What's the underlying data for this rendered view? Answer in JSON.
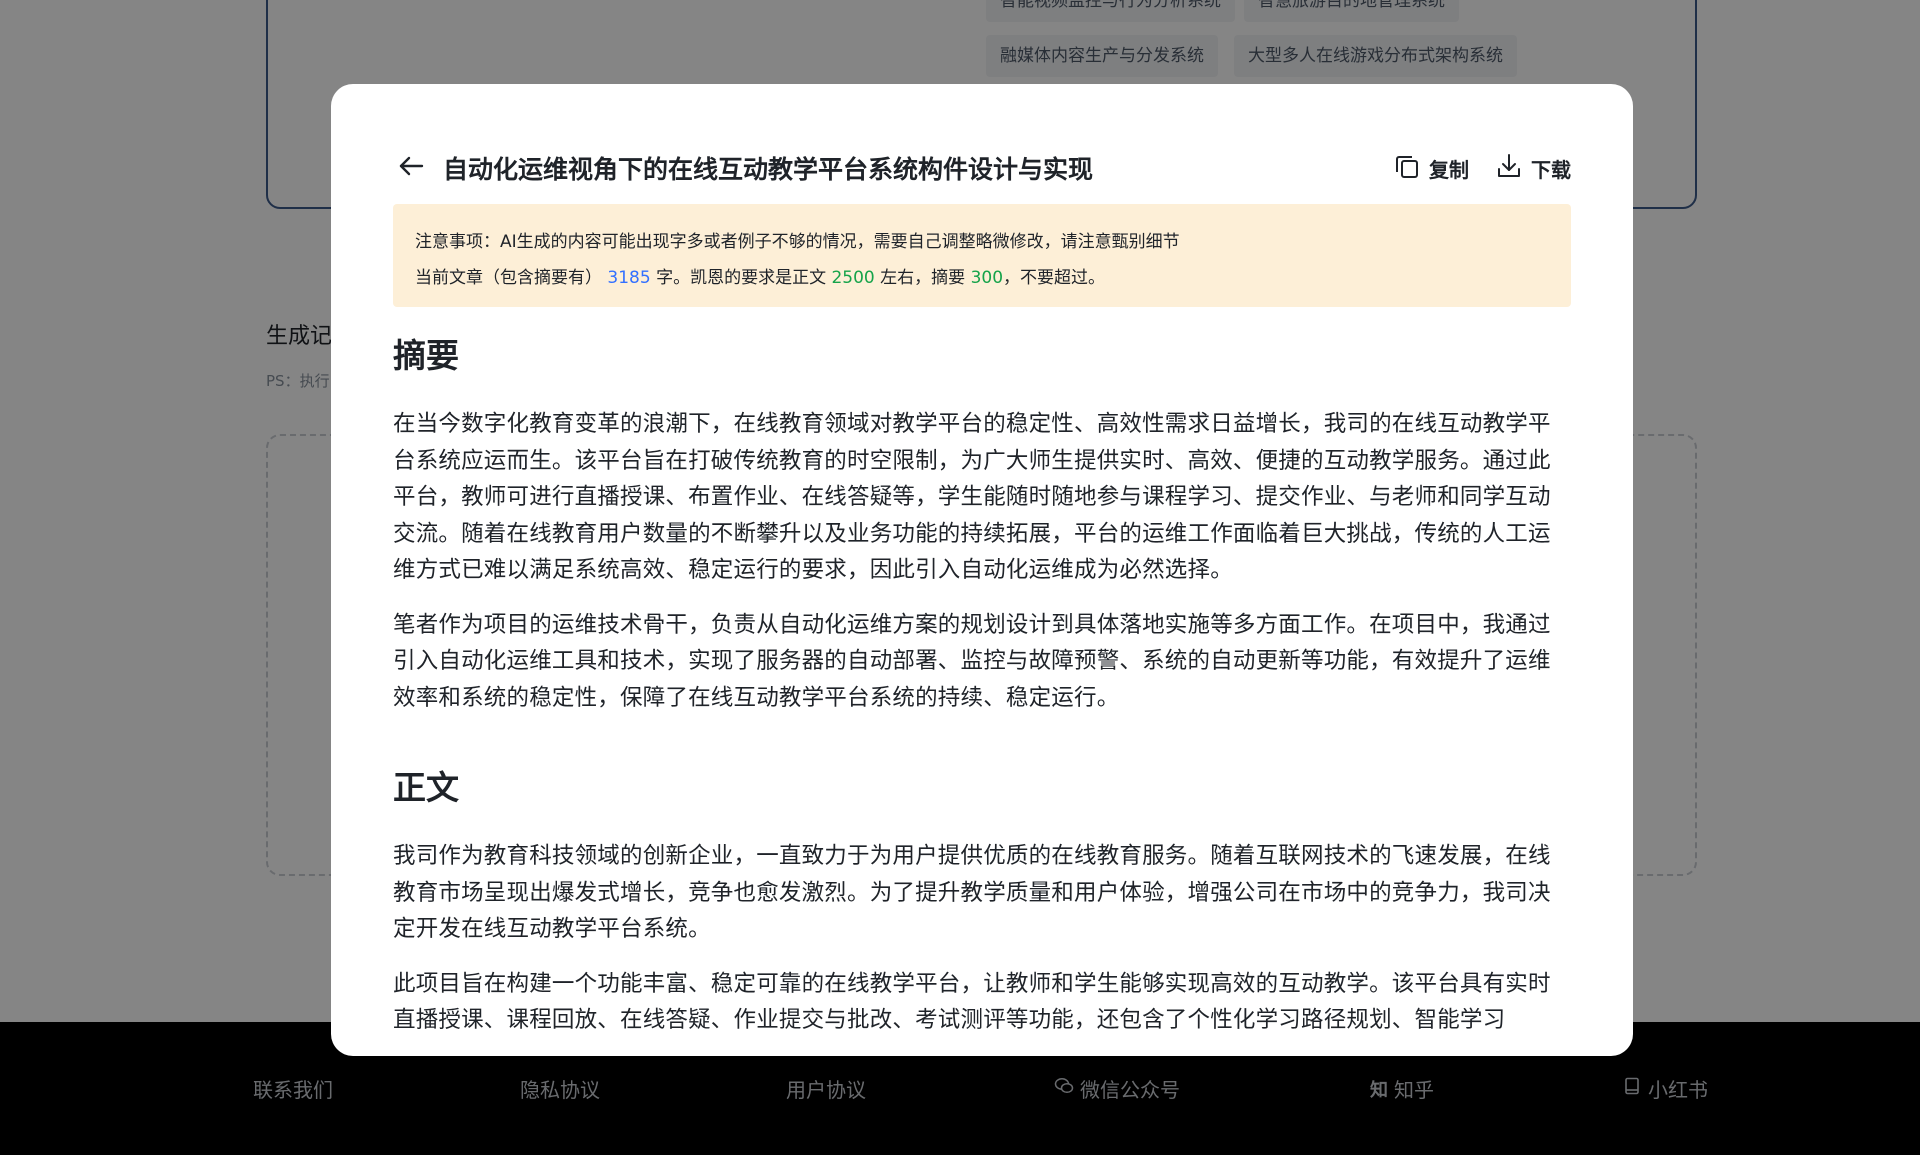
{
  "background": {
    "tags": [
      {
        "text": "智能视频监控与行为分析系统"
      },
      {
        "text": "智慧旅游目的地管理系统"
      },
      {
        "text": "融媒体内容生产与分发系统"
      },
      {
        "text": "大型多人在线游戏分布式架构系统"
      }
    ],
    "section_title": "生成记",
    "ps_text": "PS：执行"
  },
  "footer": {
    "links": [
      {
        "label": "联系我们"
      },
      {
        "label": "隐私协议"
      },
      {
        "label": "用户协议"
      },
      {
        "label": "微信公众号"
      },
      {
        "label": "知乎"
      },
      {
        "label": "小红书"
      }
    ]
  },
  "modal": {
    "title": "自动化运维视角下的在线互动教学平台系统构件设计与实现",
    "copy_label": "复制",
    "download_label": "下载",
    "notice": {
      "line1": "注意事项：AI生成的内容可能出现字多或者例子不够的情况，需要自己调整略微修改，请注意甄别细节",
      "line2_prefix": "当前文章（包含摘要有）",
      "word_count": "3185",
      "line2_mid1": "字。凯恩的要求是正文",
      "body_target": "2500",
      "line2_mid2": "左右，摘要",
      "abstract_target": "300",
      "line2_suffix": "，不要超过。"
    },
    "sections": {
      "abstract_heading": "摘要",
      "abstract_p1": "在当今数字化教育变革的浪潮下，在线教育领域对教学平台的稳定性、高效性需求日益增长，我司的在线互动教学平台系统应运而生。该平台旨在打破传统教育的时空限制，为广大师生提供实时、高效、便捷的互动教学服务。通过此平台，教师可进行直播授课、布置作业、在线答疑等，学生能随时随地参与课程学习、提交作业、与老师和同学互动交流。随着在线教育用户数量的不断攀升以及业务功能的持续拓展，平台的运维工作面临着巨大挑战，传统的人工运维方式已难以满足系统高效、稳定运行的要求，因此引入自动化运维成为必然选择。",
      "abstract_p2": "笔者作为项目的运维技术骨干，负责从自动化运维方案的规划设计到具体落地实施等多方面工作。在项目中，我通过引入自动化运维工具和技术，实现了服务器的自动部署、监控与故障预警、系统的自动更新等功能，有效提升了运维效率和系统的稳定性，保障了在线互动教学平台系统的持续、稳定运行。",
      "body_heading": "正文",
      "body_p1": "我司作为教育科技领域的创新企业，一直致力于为用户提供优质的在线教育服务。随着互联网技术的飞速发展，在线教育市场呈现出爆发式增长，竞争也愈发激烈。为了提升教学质量和用户体验，增强公司在市场中的竞争力，我司决定开发在线互动教学平台系统。",
      "body_p2": "此项目旨在构建一个功能丰富、稳定可靠的在线教学平台，让教师和学生能够实现高效的互动教学。该平台具有实时直播授课、课程回放、在线答疑、作业提交与批改、考试测评等功能，还包含了个性化学习路径规划、智能学习"
    }
  }
}
